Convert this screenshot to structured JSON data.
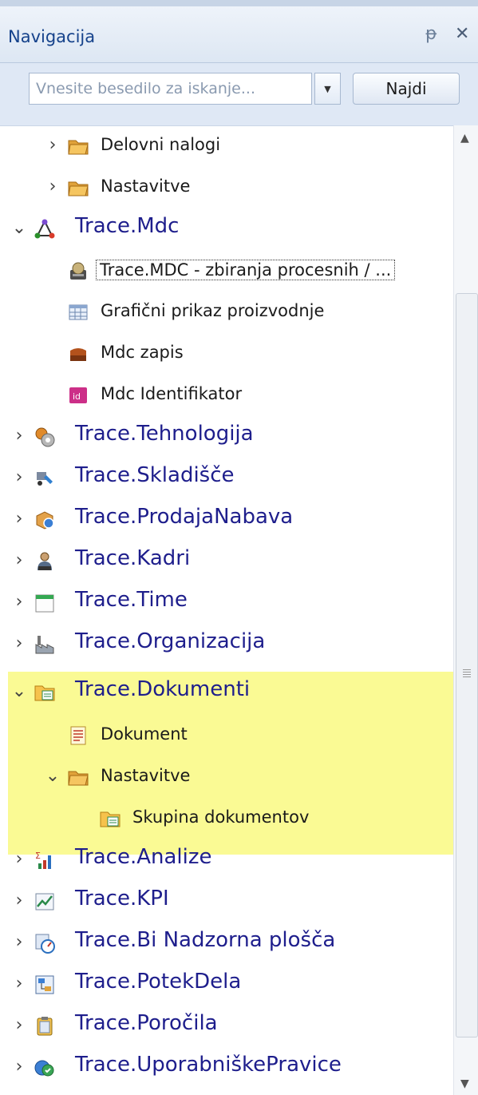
{
  "panel": {
    "title": "Navigacija",
    "pin_glyph": "ᵽ",
    "close_glyph": "✕"
  },
  "search": {
    "placeholder": "Vnesite besedilo za iskanje...",
    "find_label": "Najdi",
    "dropdown_glyph": "▼"
  },
  "tree": {
    "delovni_nalogi": "Delovni nalogi",
    "nastavitve_1": "Nastavitve",
    "trace_mdc": "Trace.Mdc",
    "mdc_zbiranja": "Trace.MDC - zbiranja procesnih / ...",
    "graficni_prikaz": "Grafični prikaz proizvodnje",
    "mdc_zapis": "Mdc zapis",
    "mdc_identifikator": "Mdc Identifikator",
    "tehnologija": "Trace.Tehnologija",
    "skladisce": "Trace.Skladišče",
    "prodaja_nabava": "Trace.ProdajaNabava",
    "kadri": "Trace.Kadri",
    "time": "Trace.Time",
    "organizacija": "Trace.Organizacija",
    "dokumenti": "Trace.Dokumenti",
    "dokument": "Dokument",
    "nastavitve_2": "Nastavitve",
    "skupina_dokumentov": "Skupina dokumentov",
    "analize": "Trace.Analize",
    "kpi": "Trace.KPI",
    "bi_nadzorna": "Trace.Bi Nadzorna plošča",
    "potek_dela": "Trace.PotekDela",
    "porocila": "Trace.Poročila",
    "uporabniske_pravice": "Trace.UporabniškePravice"
  },
  "colors": {
    "highlight": "#fafa94",
    "root_text": "#1e1e8c",
    "header_text": "#15428b"
  },
  "icons": {
    "expanded": "⌄",
    "collapsed": "›"
  }
}
